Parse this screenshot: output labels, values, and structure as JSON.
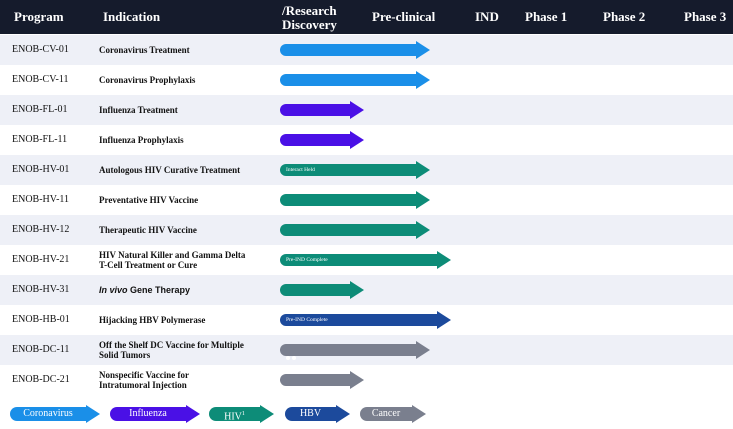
{
  "header": {
    "program": "Program",
    "indication": "Indication",
    "research_line1": "/Research",
    "research_line2": "Discovery",
    "preclinical": "Pre-clinical",
    "ind": "IND",
    "phase1": "Phase 1",
    "phase2": "Phase 2",
    "phase3": "Phase 3"
  },
  "colors": {
    "coronavirus": "#1a8fe8",
    "influenza": "#4a10e6",
    "hiv": "#0d8c78",
    "hbv": "#1c4a9c",
    "cancer": "#7a7f8e",
    "header_bg": "#151b2c"
  },
  "rows": [
    {
      "program": "ENOB-CV-01",
      "indication": "Coronavirus Treatment",
      "category": "coronavirus",
      "stage_end": "preclinical",
      "label": ""
    },
    {
      "program": "ENOB-CV-11",
      "indication": "Coronavirus Prophylaxis",
      "category": "coronavirus",
      "stage_end": "preclinical",
      "label": ""
    },
    {
      "program": "ENOB-FL-01",
      "indication": "Influenza Treatment",
      "category": "influenza",
      "stage_end": "discovery",
      "label": ""
    },
    {
      "program": "ENOB-FL-11",
      "indication": "Influenza Prophylaxis",
      "category": "influenza",
      "stage_end": "discovery",
      "label": ""
    },
    {
      "program": "ENOB-HV-01",
      "indication": "Autologous HIV Curative Treatment",
      "category": "hiv",
      "stage_end": "preclinical",
      "label": "Interact Held"
    },
    {
      "program": "ENOB-HV-11",
      "indication": "Preventative HIV Vaccine",
      "category": "hiv",
      "stage_end": "preclinical",
      "label": ""
    },
    {
      "program": "ENOB-HV-12",
      "indication": "Therapeutic HIV Vaccine",
      "category": "hiv",
      "stage_end": "preclinical",
      "label": ""
    },
    {
      "program": "ENOB-HV-21",
      "indication_line1": "HIV Natural Killer and Gamma Delta",
      "indication_line2": "T-Cell Treatment or Cure",
      "category": "hiv",
      "stage_end": "preclinical_plus",
      "label": "Pre-IND Complete"
    },
    {
      "program": "ENOB-HV-31",
      "indication_italic": "In vivo",
      "indication_rest": "Gene Therapy",
      "category": "hiv",
      "stage_end": "discovery",
      "label": ""
    },
    {
      "program": "ENOB-HB-01",
      "indication": "Hijacking HBV Polymerase",
      "category": "hbv",
      "stage_end": "preclinical_plus",
      "label": "Pre-IND Complete"
    },
    {
      "program": "ENOB-DC-11",
      "indication_line1": "Off the Shelf DC Vaccine for Multiple",
      "indication_line2": "Solid Tumors",
      "category": "cancer",
      "stage_end": "preclinical",
      "label": "dots"
    },
    {
      "program": "ENOB-DC-21",
      "indication_line1": "Nonspecific Vaccine for",
      "indication_line2": "Intratumoral Injection",
      "category": "cancer",
      "stage_end": "discovery",
      "label": ""
    }
  ],
  "legend": [
    {
      "label": "Coronavirus",
      "category": "coronavirus"
    },
    {
      "label": "Influenza",
      "category": "influenza"
    },
    {
      "label": "HIV",
      "sup": "1",
      "category": "hiv"
    },
    {
      "label": "HBV",
      "category": "hbv"
    },
    {
      "label": "Cancer",
      "category": "cancer"
    }
  ]
}
